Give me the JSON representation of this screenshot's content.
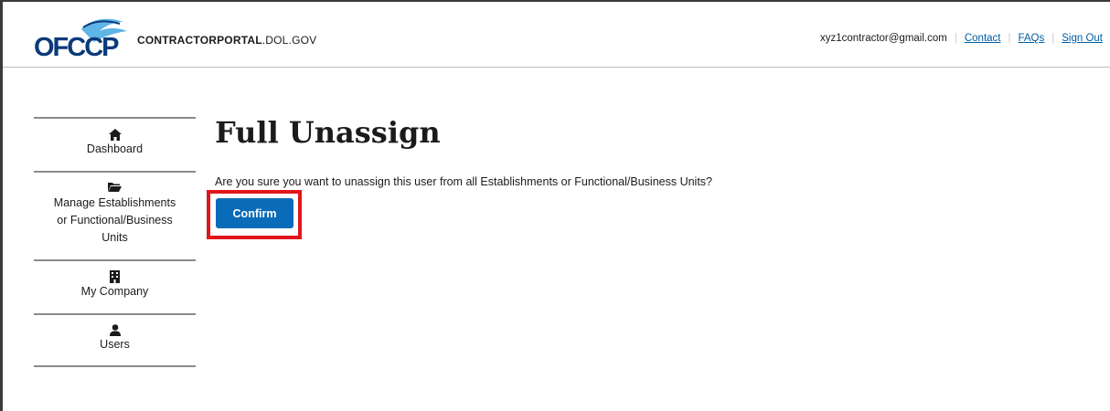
{
  "header": {
    "logo_text": "OFCCP",
    "site_name_bold": "CONTRACTORPORTAL",
    "site_name_rest": ".DOL.GOV",
    "user_email": "xyz1contractor@gmail.com",
    "links": {
      "contact": "Contact",
      "faqs": "FAQs",
      "sign_out": "Sign Out"
    }
  },
  "sidebar": {
    "items": [
      {
        "label": "Dashboard",
        "icon": "home-icon"
      },
      {
        "label_lines": [
          "Manage Establishments",
          "or Functional/Business",
          "Units"
        ],
        "icon": "folder-icon"
      },
      {
        "label": "My Company",
        "icon": "building-icon"
      },
      {
        "label": "Users",
        "icon": "user-icon"
      }
    ]
  },
  "main": {
    "title": "Full Unassign",
    "prompt": "Are you sure you want to unassign this user from all Establishments or Functional/Business Units?",
    "confirm_label": "Confirm"
  },
  "colors": {
    "primary": "#0a6bb8",
    "link": "#005ea2",
    "highlight": "#e0161b"
  }
}
